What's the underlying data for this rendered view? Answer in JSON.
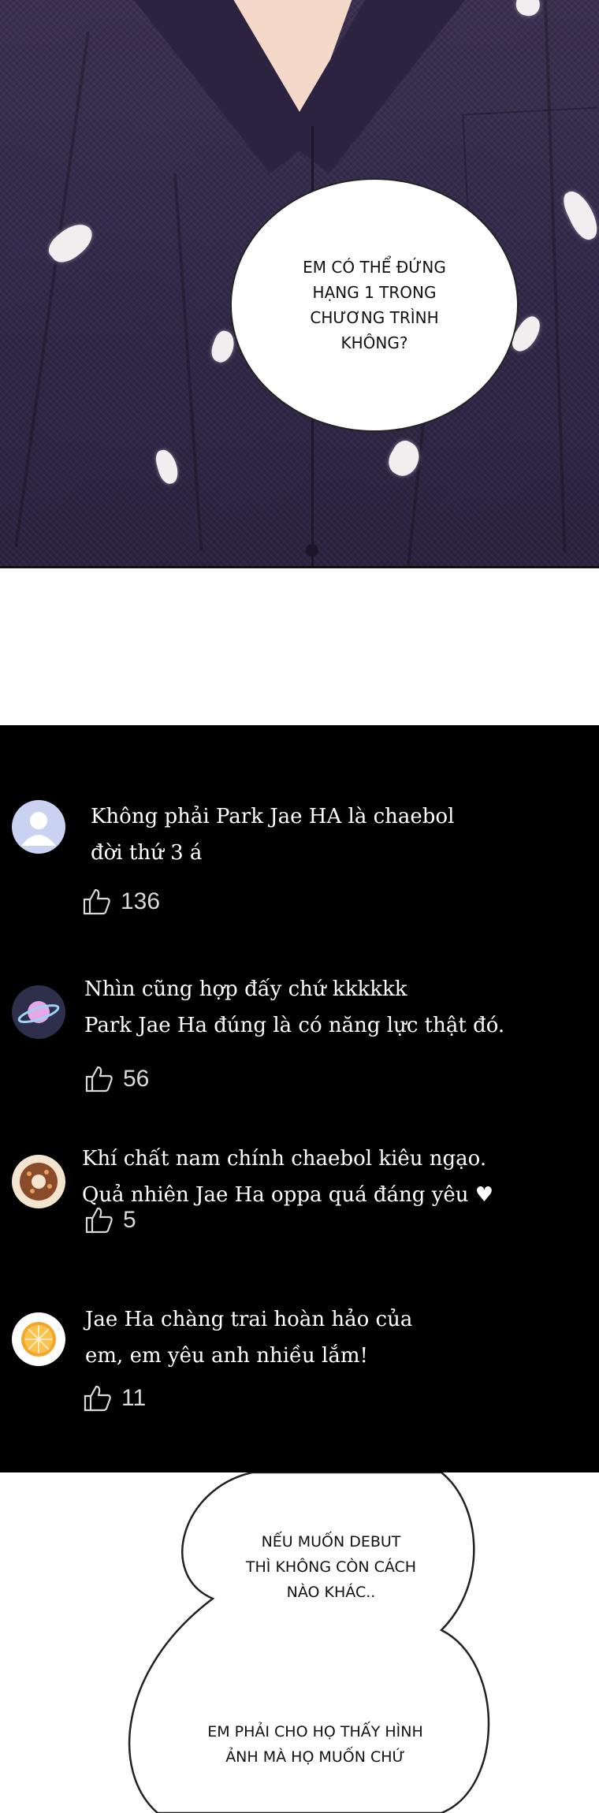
{
  "panel_top": {
    "speech": "EM CÓ THỂ ĐỨNG\nHẠNG 1 TRONG\nCHƯƠNG TRÌNH\nKHÔNG?"
  },
  "comments": [
    {
      "avatar": "default-user-icon",
      "text": "Không phải Park Jae HA là chaebol\nđời thứ 3 á",
      "likes": "136"
    },
    {
      "avatar": "planet-icon",
      "text": "Nhìn cũng hợp đấy chứ kkkkkk\nPark Jae Ha đúng là có năng lực thật đó.",
      "likes": "56"
    },
    {
      "avatar": "donut-icon",
      "text": "Khí chất nam chính chaebol kiêu ngạo.\nQuả nhiên Jae Ha oppa quá đáng yêu ♥",
      "likes": "5"
    },
    {
      "avatar": "orange-slice-icon",
      "text": "Jae Ha chàng trai hoàn hảo của\nem, em yêu anh nhiều lắm!",
      "likes": "11"
    }
  ],
  "panel_bottom": {
    "speech_1": "NẾU MUỐN DEBUT\nTHÌ KHÔNG CÒN CÁCH\nNÀO KHÁC..",
    "speech_2": "EM PHẢI CHO HỌ THẤY HÌNH\nẢNH MÀ HỌ MUỐN CHỨ"
  }
}
